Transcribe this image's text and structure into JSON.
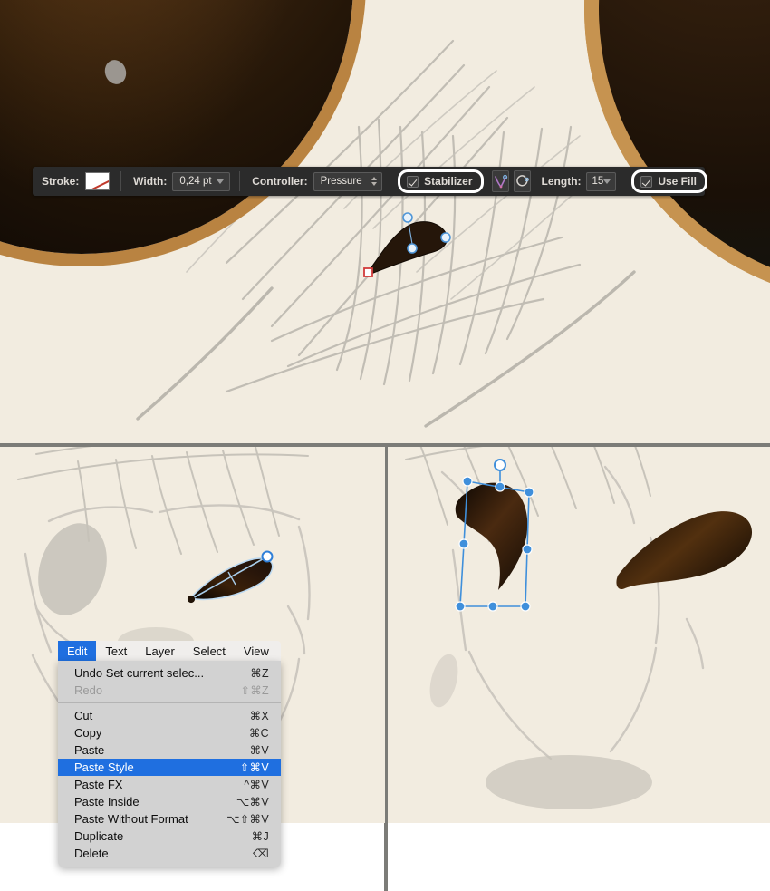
{
  "toolbar": {
    "stroke_label": "Stroke:",
    "stroke_swatch_icon": "no-stroke-swatch",
    "width_label": "Width:",
    "width_value": "0,24 pt",
    "controller_label": "Controller:",
    "controller_value": "Pressure",
    "stabilizer_label": "Stabilizer",
    "stabilizer_checked": true,
    "vector_path_icon": "vector-path-icon",
    "smooth_rotate_icon": "smooth-rotate-icon",
    "length_label": "Length:",
    "length_value": "15",
    "use_fill_label": "Use Fill",
    "use_fill_checked": true
  },
  "menubar": {
    "items": [
      {
        "label": "Edit",
        "active": true
      },
      {
        "label": "Text",
        "active": false
      },
      {
        "label": "Layer",
        "active": false
      },
      {
        "label": "Select",
        "active": false
      },
      {
        "label": "View",
        "active": false
      }
    ]
  },
  "edit_menu": {
    "items": [
      {
        "label": "Undo Set current selec...",
        "shortcut": "⌘Z",
        "state": "normal"
      },
      {
        "label": "Redo",
        "shortcut": "⇧⌘Z",
        "state": "disabled"
      },
      {
        "separator": true
      },
      {
        "label": "Cut",
        "shortcut": "⌘X",
        "state": "normal"
      },
      {
        "label": "Copy",
        "shortcut": "⌘C",
        "state": "normal"
      },
      {
        "label": "Paste",
        "shortcut": "⌘V",
        "state": "normal"
      },
      {
        "label": "Paste Style",
        "shortcut": "⇧⌘V",
        "state": "selected"
      },
      {
        "label": "Paste FX",
        "shortcut": "^⌘V",
        "state": "normal"
      },
      {
        "label": "Paste Inside",
        "shortcut": "⌥⌘V",
        "state": "normal"
      },
      {
        "label": "Paste Without Format",
        "shortcut": "⌥⇧⌘V",
        "state": "normal"
      },
      {
        "label": "Duplicate",
        "shortcut": "⌘J",
        "state": "normal"
      },
      {
        "label": "Delete",
        "shortcut": "⌫",
        "state": "normal"
      }
    ]
  },
  "canvas": {
    "panels": [
      {
        "name": "top-panel-eyes-closeup"
      },
      {
        "name": "bottom-left-panel-eyebrow-stroke"
      },
      {
        "name": "bottom-right-panel-eyebrow-pair"
      }
    ],
    "artwork": {
      "skin_color": "#f2ece0",
      "sketch_line_color": "#b9b5ad",
      "eyebrow_dark": "#1a0f06",
      "eyebrow_mid": "#4a2a10",
      "eye_iris_dark": "#140c05",
      "eye_rim_gold": "#c18e49",
      "selection_blue": "#2f7fd8",
      "anchor_red": "#d23b3b",
      "handle_fill": "#e8f2fb"
    },
    "top_shape": {
      "name": "selected-brush-stroke",
      "anchors": 3,
      "red_anchor": 1
    },
    "midleft_shape": {
      "name": "eyebrow-with-path-selection"
    },
    "midright_shape_a": {
      "name": "eyebrow-with-transform-box",
      "handles": 8,
      "rotation_handle": 1
    },
    "midright_shape_b": {
      "name": "eyebrow-unselected"
    }
  }
}
